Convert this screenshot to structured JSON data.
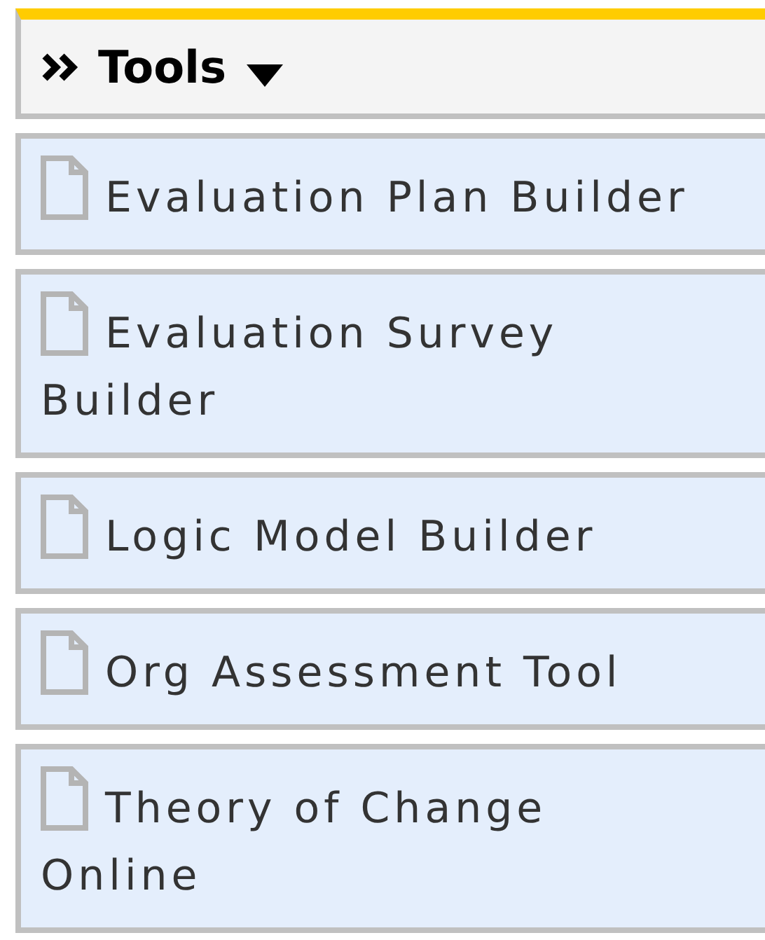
{
  "panel": {
    "title": "Tools",
    "items": [
      {
        "label": "Evaluation Plan Builder"
      },
      {
        "label": "Evaluation Survey Builder"
      },
      {
        "label": "Logic Model Builder"
      },
      {
        "label": "Org Assessment Tool"
      },
      {
        "label": "Theory of Change Online"
      }
    ]
  }
}
